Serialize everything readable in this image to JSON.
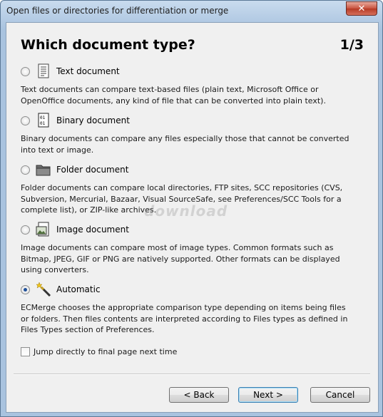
{
  "window": {
    "title": "Open files or directories for differentiation or merge",
    "close_glyph": "✕"
  },
  "page": {
    "heading": "Which document type?",
    "page_indicator": "1/3"
  },
  "options": [
    {
      "label": "Text document",
      "icon": "text-document-icon",
      "checked": false,
      "description": "Text documents can compare text-based files (plain text, Microsoft Office or OpenOffice documents, any kind of file that can be converted into plain text)."
    },
    {
      "label": "Binary document",
      "icon": "binary-document-icon",
      "checked": false,
      "description": "Binary documents can compare any files especially those that cannot be converted into text or image."
    },
    {
      "label": "Folder document",
      "icon": "folder-icon",
      "checked": false,
      "description": "Folder documents can compare local directories, FTP sites, SCC repositories (CVS, Subversion, Mercurial, Bazaar, Visual SourceSafe, see Preferences/SCC Tools for a complete list), or ZIP-like archives."
    },
    {
      "label": "Image document",
      "icon": "image-document-icon",
      "checked": false,
      "description": "Image documents can compare most of image types. Common formats such as Bitmap, JPEG, GIF or PNG are natively supported. Other formats can be displayed using converters."
    },
    {
      "label": "Automatic",
      "icon": "magic-wand-icon",
      "checked": true,
      "description": "ECMerge chooses the appropriate comparison type depending on items being files or folders. Then files contents are interpreted according to Files types as defined in Files Types section of Preferences."
    }
  ],
  "jump_checkbox": {
    "label": "Jump directly to final page next time",
    "checked": false
  },
  "buttons": {
    "back": "< Back",
    "next": "Next >",
    "cancel": "Cancel"
  },
  "watermark": "download"
}
